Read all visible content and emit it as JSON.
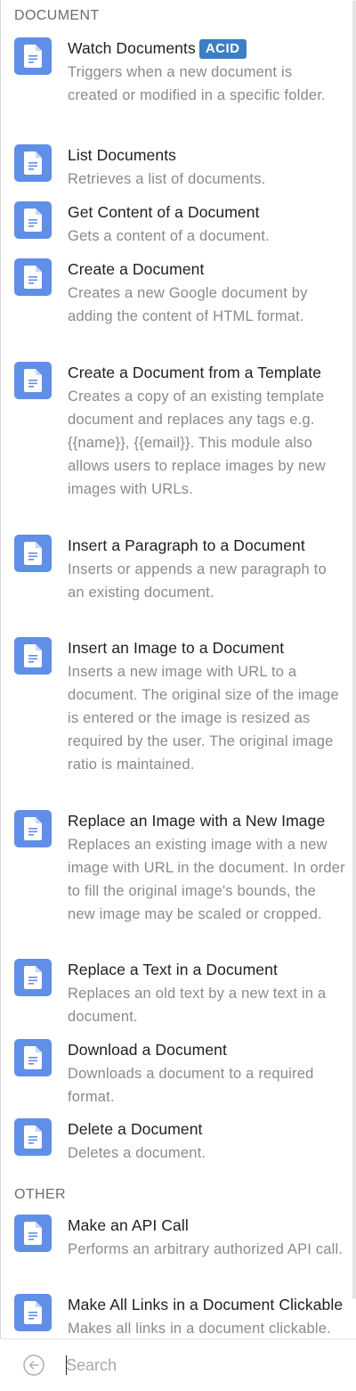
{
  "sections": {
    "document": "DOCUMENT",
    "other": "OTHER"
  },
  "modules": [
    {
      "title": "Watch Documents",
      "badge": "ACID",
      "description": "Triggers when a new document is created or modified in a specific folder."
    },
    {
      "title": "List Documents",
      "description": "Retrieves a list of documents."
    },
    {
      "title": "Get Content of a Document",
      "description": "Gets a content of a document."
    },
    {
      "title": "Create a Document",
      "description": "Creates a new Google document by adding the content of HTML format."
    },
    {
      "title": "Create a Document from a Template",
      "description": "Creates a copy of an existing template document and replaces any tags e.g. {{name}}, {{email}}. This module also allows users to replace images by new images with URLs."
    },
    {
      "title": "Insert a Paragraph to a Document",
      "description": "Inserts or appends a new paragraph to an existing document."
    },
    {
      "title": "Insert an Image to a Document",
      "description": "Inserts a new image with URL to a document. The original size of the image is entered or the image is resized as required by the user. The original image ratio is maintained."
    },
    {
      "title": "Replace an Image with a New Image",
      "description": "Replaces an existing image with a new image with URL in the document. In order to fill the original image's bounds, the new image may be scaled or cropped."
    },
    {
      "title": "Replace a Text in a Document",
      "description": "Replaces an old text by a new text in a document."
    },
    {
      "title": "Download a Document",
      "description": "Downloads a document to a required format."
    },
    {
      "title": "Delete a Document",
      "description": "Deletes a document."
    },
    {
      "title": "Make an API Call",
      "description": "Performs an arbitrary authorized API call."
    },
    {
      "title": "Make All Links in a Document Clickable",
      "description": "Makes all links in a document clickable."
    }
  ],
  "search": {
    "placeholder": "Search"
  },
  "icons": {
    "module": "google-docs-icon",
    "back": "back-arrow-circle-icon"
  },
  "colors": {
    "icon_bg": "#5f8fe6",
    "badge_bg": "#3b7fc4"
  }
}
